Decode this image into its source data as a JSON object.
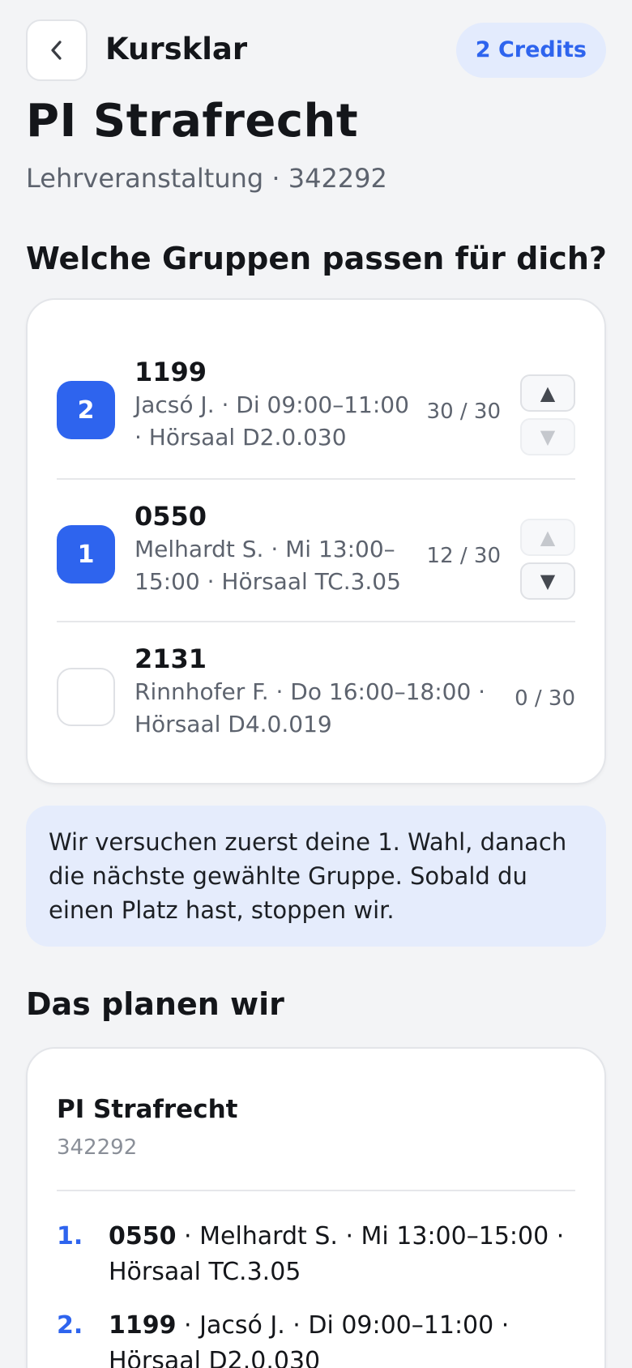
{
  "header": {
    "app_title": "Kursklar",
    "credits": "2 Credits",
    "back_icon": "chevron-left-icon"
  },
  "course": {
    "title": "PI Strafrecht",
    "subtitle": "Lehrveranstaltung · 342292"
  },
  "groups_section": {
    "heading": "Welche Gruppen passen für dich?",
    "groups": [
      {
        "rank": "2",
        "selected": true,
        "code": "1199",
        "detail": "Jacsó J. · Di 09:00–11:00 · Hörsaal D2.0.030",
        "capacity": "30 / 30",
        "up_enabled": true,
        "down_enabled": false
      },
      {
        "rank": "1",
        "selected": true,
        "code": "0550",
        "detail": "Melhardt S. · Mi 13:00–15:00 · Hörsaal TC.3.05",
        "capacity": "12 / 30",
        "up_enabled": false,
        "down_enabled": true
      },
      {
        "rank": "",
        "selected": false,
        "code": "2131",
        "detail": "Rinnhofer F. · Do 16:00–18:00 · Hörsaal D4.0.019",
        "capacity": "0 / 30"
      }
    ],
    "arrow_up": "▲",
    "arrow_down": "▼"
  },
  "info": {
    "text": "Wir versuchen zuerst deine 1. Wahl, danach die nächste gewählte Gruppe. Sobald du einen Platz hast, stoppen wir."
  },
  "plan_section": {
    "heading": "Das planen wir",
    "title": "PI Strafrecht",
    "code": "342292",
    "items": [
      {
        "num": "1.",
        "code": "0550",
        "rest": " · Melhardt S. · Mi 13:00–15:00 · Hörsaal TC.3.05"
      },
      {
        "num": "2.",
        "code": "1199",
        "rest": " · Jacsó J. · Di 09:00–11:00 · Hörsaal D2.0.030"
      }
    ]
  },
  "colors": {
    "accent": "#2e64ee",
    "accent_soft": "#e3ebfd",
    "background": "#f3f4f6"
  }
}
